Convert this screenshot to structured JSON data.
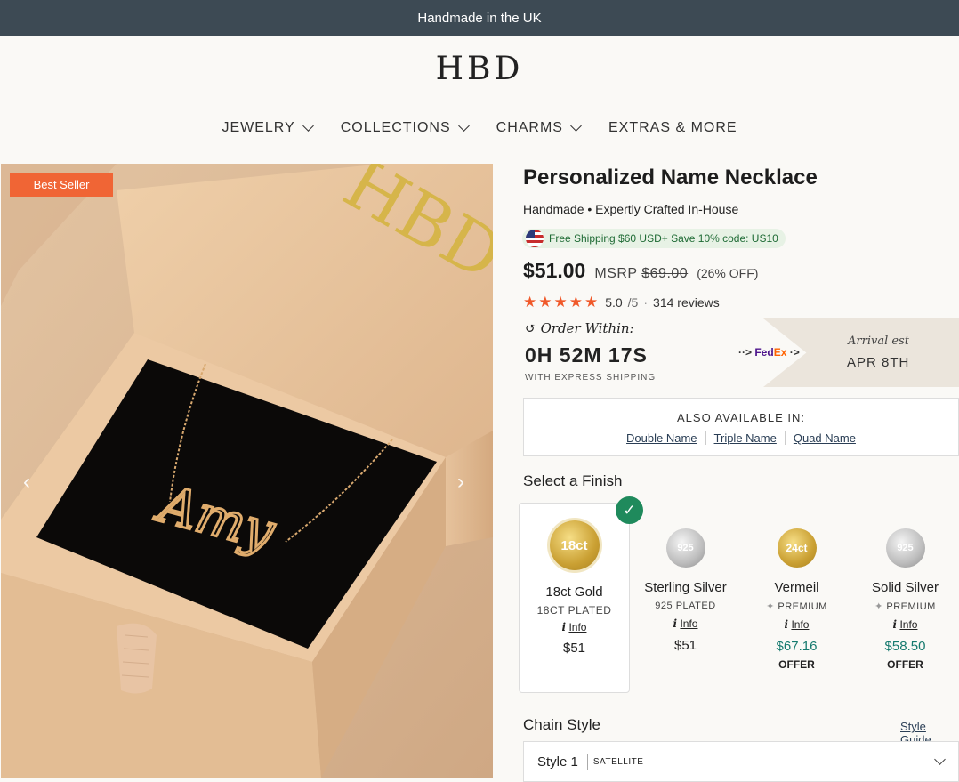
{
  "banner": "Handmade in the UK",
  "logo": "HBD",
  "nav": [
    {
      "label": "JEWELRY",
      "dropdown": true
    },
    {
      "label": "COLLECTIONS",
      "dropdown": true
    },
    {
      "label": "CHARMS",
      "dropdown": true
    },
    {
      "label": "EXTRAS & MORE",
      "dropdown": false
    }
  ],
  "hero": {
    "badge": "Best Seller",
    "box_logo": "HBD",
    "necklace_name": "Amy"
  },
  "product": {
    "title": "Personalized Name Necklace",
    "subtitle": "Handmade • Expertly Crafted In-House",
    "shipping_promo": "Free Shipping $60 USD+ Save 10% code: US10",
    "price": "$51.00",
    "msrp_label": "MSRP",
    "msrp": "$69.00",
    "discount": "(26% OFF)",
    "rating": "5.0",
    "rating_max": "/5",
    "reviews": "314 reviews"
  },
  "delivery": {
    "order_within": "Order Within:",
    "countdown": "0H 52M 17S",
    "express": "WITH EXPRESS SHIPPING",
    "carrier": "FedEx",
    "arrival_label": "Arrival est",
    "arrival_date": "APR 8TH"
  },
  "also_available": {
    "heading": "ALSO AVAILABLE IN:",
    "links": [
      "Double Name",
      "Triple Name",
      "Quad Name"
    ]
  },
  "finish": {
    "heading": "Select a Finish",
    "options": [
      {
        "coin": "18ct",
        "name": "18ct Gold",
        "sub": "18CT PLATED",
        "info": "Info",
        "price": "$51",
        "offer": "",
        "selected": true
      },
      {
        "coin": "925",
        "name": "Sterling Silver",
        "sub": "925 PLATED",
        "info": "Info",
        "price": "$51",
        "offer": "",
        "selected": false
      },
      {
        "coin": "24ct",
        "name": "Vermeil",
        "sub": "PREMIUM",
        "info": "Info",
        "price": "$67.16",
        "offer": "OFFER",
        "selected": false
      },
      {
        "coin": "925",
        "name": "Solid Silver",
        "sub": "PREMIUM",
        "info": "Info",
        "price": "$58.50",
        "offer": "OFFER",
        "selected": false
      }
    ]
  },
  "chain": {
    "heading": "Chain Style",
    "guide": "Style Guide",
    "selected": "Style 1",
    "tag": "SATELLITE"
  },
  "colors": {
    "topbar": "#3d4a54",
    "badge": "#f06535",
    "star": "#f0592a",
    "check": "#1f8a5c",
    "offer_price": "#157a6e"
  }
}
